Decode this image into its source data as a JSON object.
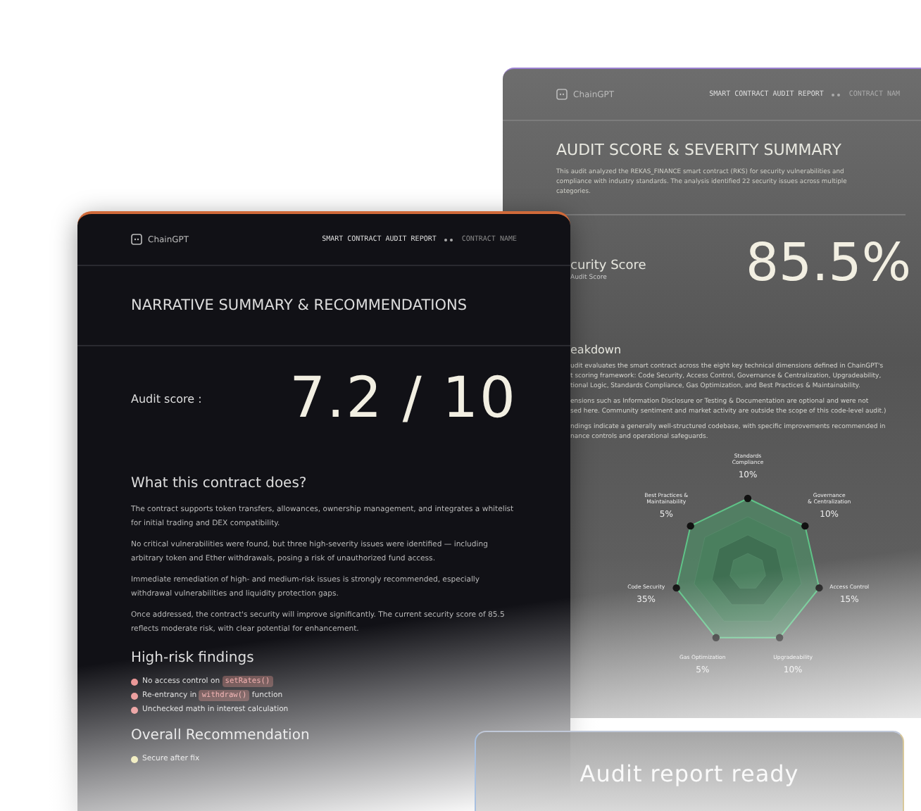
{
  "back_report": {
    "header": {
      "logo": "ChainGPT",
      "breadcrumb": "SMART CONTRACT AUDIT REPORT",
      "current": "CONTRACT NAM"
    },
    "title": "AUDIT SCORE & SEVERITY SUMMARY",
    "intro": "This audit analyzed the REKAS_FINANCE smart contract (RKS) for security vulnerabilities and compliance with industry standards. The analysis identified 22 security issues across multiple categories.",
    "score_label": "curity Score",
    "score_sublabel": "Audit Score",
    "score": "85.5%",
    "breakdown_heading": "eakdown",
    "breakdown_paragraphs": [
      [
        "udit evaluates the smart contract across the eight key technical dimensions defined in ChainGPT's",
        "t scoring framework: Code Security, Access Control, Governance & Centralization, Upgradeability,",
        "tional Logic, Standards Compliance, Gas Optimization, and Best Practices & Maintainability."
      ],
      [
        "ensions such as Information Disclosure or Testing & Documentation are optional and were not",
        "sed here. Community sentiment and market activity are outside the scope of this code-level audit.)"
      ],
      [
        "ndings indicate a generally well-structured codebase, with specific improvements recommended in",
        "nance controls and operational safeguards."
      ]
    ],
    "radar": [
      {
        "label": [
          "Standards",
          "Compliance"
        ],
        "value": "10%"
      },
      {
        "label": [
          "Best Practices &",
          "Maintainability"
        ],
        "value": "5%"
      },
      {
        "label": [
          "Governance",
          "& Centralization"
        ],
        "value": "10%"
      },
      {
        "label": [
          "Code Security"
        ],
        "value": "35%"
      },
      {
        "label": [
          "Access Control"
        ],
        "value": "15%"
      },
      {
        "label": [
          "Gas Optimization"
        ],
        "value": "5%"
      },
      {
        "label": [
          "Upgradeability"
        ],
        "value": "10%"
      }
    ]
  },
  "front_report": {
    "header": {
      "logo": "ChainGPT",
      "breadcrumb": "SMART CONTRACT AUDIT REPORT",
      "current": "CONTRACT NAME"
    },
    "title": "NARRATIVE SUMMARY & RECOMMENDATIONS",
    "score_label": "Audit score :",
    "score": "7.2 / 10",
    "section_heading": "What this contract does?",
    "paragraphs": [
      "The contract supports token transfers, allowances, ownership management, and integrates a whitelist for initial trading and DEX compatibility.",
      "No critical vulnerabilities were found, but three high-severity issues were identified — including arbitrary token and Ether withdrawals, posing a risk of unauthorized fund access.",
      "Immediate remediation of high- and medium-risk issues is strongly recommended, especially withdrawal vulnerabilities and liquidity protection gaps.",
      "Once addressed, the contract's security will improve significantly. The current security score of 85.5 reflects moderate risk, with clear potential for enhancement."
    ],
    "findings_heading": "High-risk findings",
    "findings": [
      {
        "before": "No access control on",
        "code": "setRates()"
      },
      {
        "before": "Re-entrancy in",
        "code": "withdraw()",
        "after": "function"
      },
      {
        "before": "Unchecked math in interest calculation"
      }
    ],
    "recommendation_heading": "Overall Recommendation",
    "recommendations": [
      "Secure after fix"
    ]
  },
  "toast": {
    "title": "Audit report ready"
  }
}
